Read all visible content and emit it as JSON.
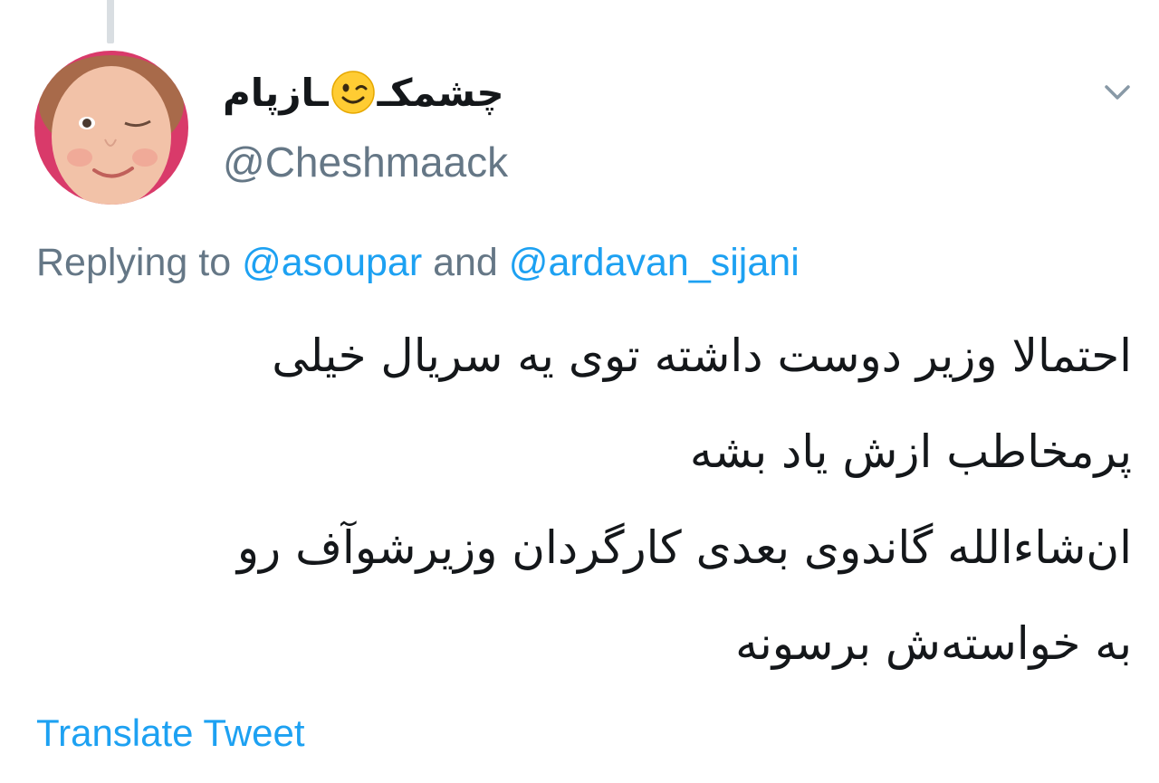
{
  "tweet": {
    "author": {
      "display_name_part1": "چشمکـ",
      "display_name_part2": "ـازپام",
      "emoji": "winking-face-emoji",
      "handle": "@Cheshmaack"
    },
    "replying_to": {
      "prefix": "Replying to",
      "mention_1": "@asoupar",
      "conjunction": "and",
      "mention_2": "@ardavan_sijani"
    },
    "text_lines": [
      "احتمالا وزیر دوست داشته توی یه سریال خیلی",
      "پرمخاطب ازش یاد بشه",
      "ان‌شاءالله گاندوی بعدی کارگردان وزیرشوآف رو",
      "به خواسته‌ش برسونه"
    ],
    "translate_label": "Translate Tweet"
  },
  "colors": {
    "link": "#1da1f2",
    "secondary_text": "#657786",
    "primary_text": "#14171a",
    "thread_line": "#d9dee2"
  },
  "icons": {
    "menu": "chevron-down-icon"
  }
}
